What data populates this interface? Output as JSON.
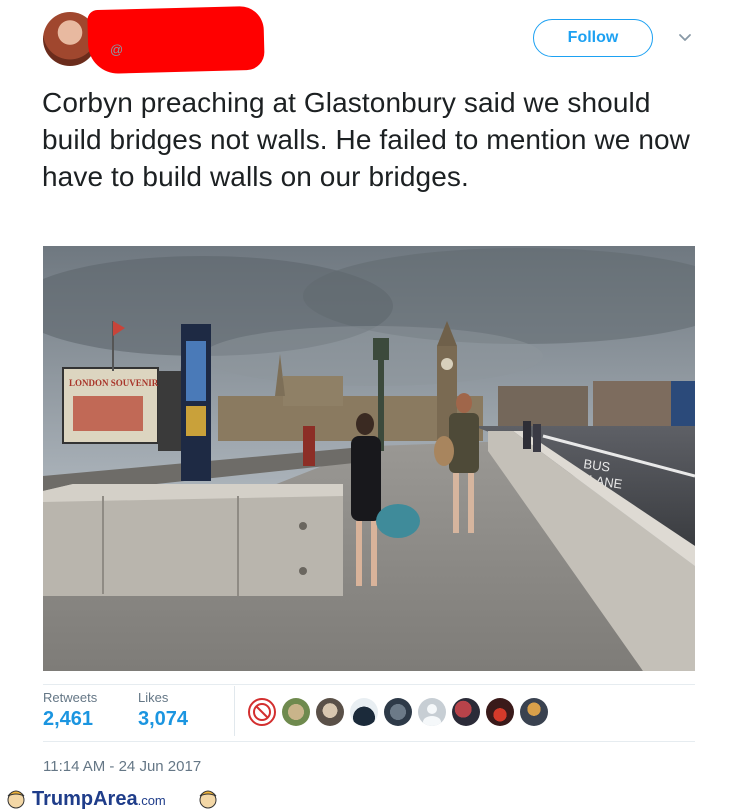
{
  "header": {
    "handle_at": "@",
    "follow_label": "Follow"
  },
  "tweet": {
    "text": "Corbyn preaching at Glastonbury said we should build bridges not walls. He failed to mention we now have to build walls on our bridges."
  },
  "photo": {
    "signs": [
      "LONDON SOUVENIRS",
      "BUS",
      "LANE"
    ]
  },
  "stats": {
    "retweets_label": "Retweets",
    "retweets_value": "2,461",
    "likes_label": "Likes",
    "likes_value": "3,074"
  },
  "timestamp": "11:14 AM - 24 Jun 2017",
  "watermark": {
    "brand": "TrumpArea",
    "tld": ".com"
  },
  "colors": {
    "accent": "#1da1f2",
    "stat_value": "#1b95e0",
    "redaction": "#ff0000",
    "watermark": "#1f3d8a"
  }
}
